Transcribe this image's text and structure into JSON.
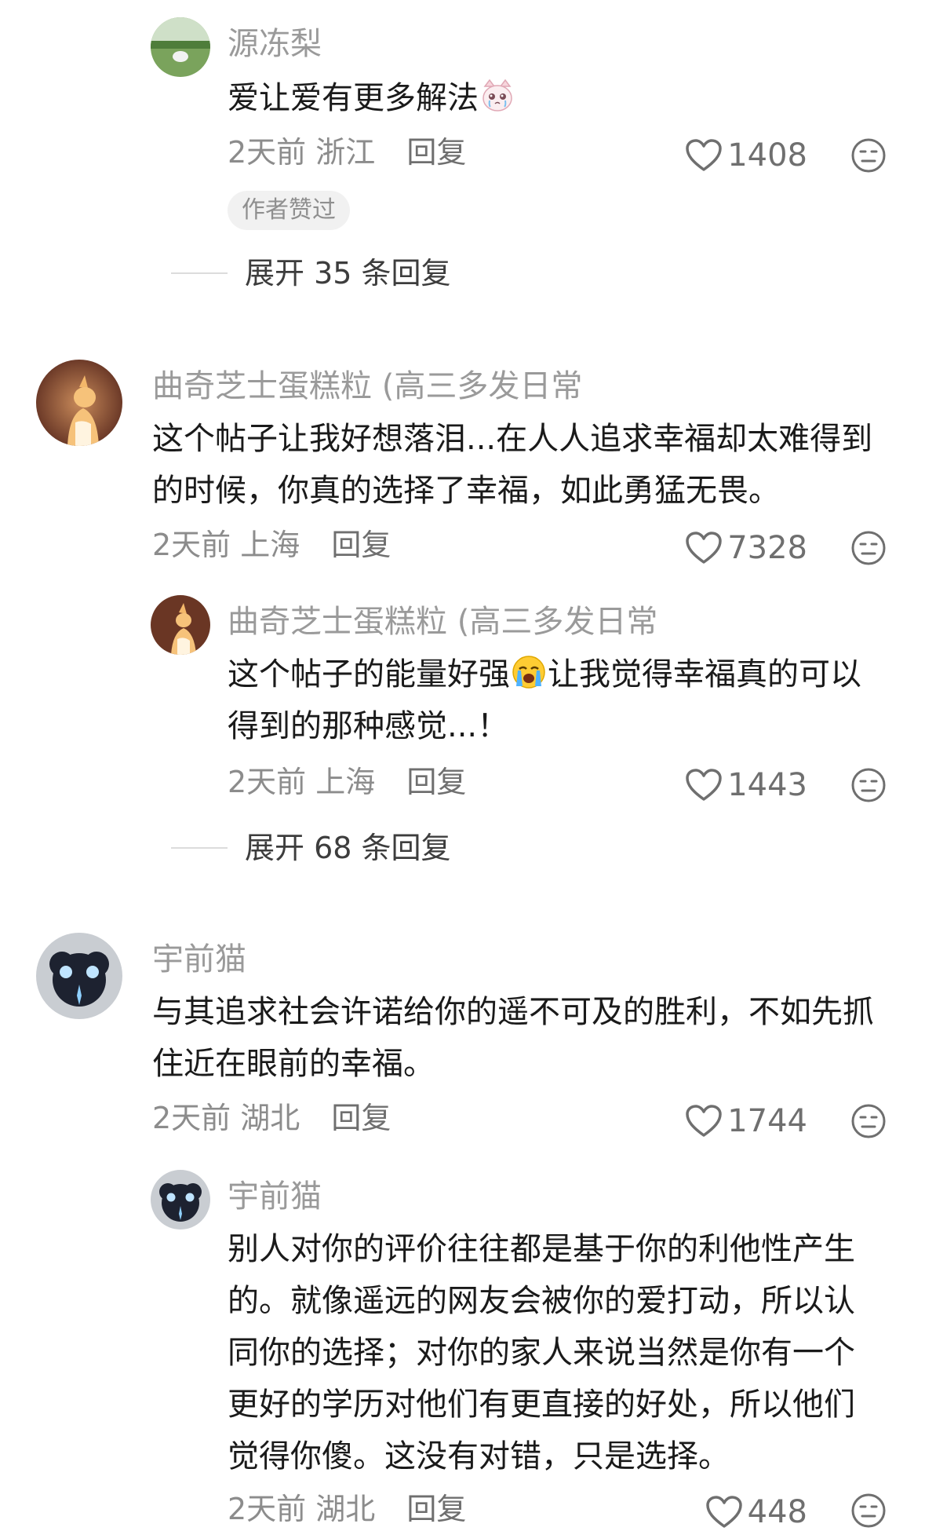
{
  "comments": [
    {
      "username": "源冻梨",
      "text_before": "爱让爱有更多解法",
      "emoji": "crying-cat-emoji",
      "time": "2天前",
      "location": "浙江",
      "reply_label": "回复",
      "likes": "1408",
      "badge": "作者赞过",
      "expand_label": "展开 35 条回复"
    },
    {
      "username": "曲奇芝士蛋糕粒 (高三多发日常",
      "text": "这个帖子让我好想落泪...在人人追求幸福却太难得到的时候，你真的选择了幸福，如此勇猛无畏。",
      "time": "2天前",
      "location": "上海",
      "reply_label": "回复",
      "likes": "7328"
    },
    {
      "username": "曲奇芝士蛋糕粒 (高三多发日常",
      "text_before": "这个帖子的能量好强",
      "emoji": "loudly-crying-face-emoji",
      "text_after": "让我觉得幸福真的可以得到的那种感觉...！",
      "time": "2天前",
      "location": "上海",
      "reply_label": "回复",
      "likes": "1443",
      "expand_label": "展开 68 条回复"
    },
    {
      "username": "宇前猫",
      "text": "与其追求社会许诺给你的遥不可及的胜利，不如先抓住近在眼前的幸福。",
      "time": "2天前",
      "location": "湖北",
      "reply_label": "回复",
      "likes": "1744"
    },
    {
      "username": "宇前猫",
      "text": "别人对你的评价往往都是基于你的利他性产生的。就像遥远的网友会被你的爱打动，所以认同你的选择；对你的家人来说当然是你有一个更好的学历对他们有更直接的好处，所以他们觉得你傻。这没有对错，只是选择。",
      "time": "2天前",
      "location": "湖北",
      "reply_label": "回复",
      "likes": "448"
    }
  ],
  "icons": {
    "like": "heart-outline-icon",
    "dislike": "neutral-face-icon"
  },
  "colors": {
    "username": "#9a9a9a",
    "meta": "#8c8c8c",
    "text": "#1a1a1a",
    "badge_bg": "#f1f1f1"
  }
}
